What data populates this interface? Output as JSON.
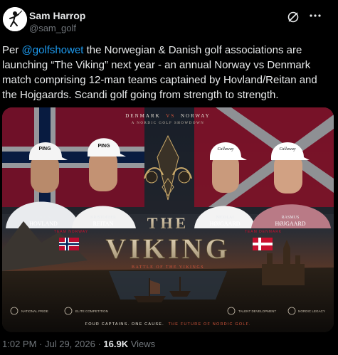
{
  "author": {
    "name": "Sam Harrop",
    "handle": "@sam_golf",
    "avatar_icon": "golfer-avatar-icon"
  },
  "tweet": {
    "text_before": "Per ",
    "mention": "@golfshowet",
    "text_after": " the Norwegian & Danish golf associations are launching “The Viking” next year - an annual Norway vs Denmark match comprising 12-man teams captained by Hovland/Reitan and the Hojgaards. Scandi golf going from strength to strength."
  },
  "poster": {
    "top_line_a": "DENMARK",
    "top_line_vs": "VS",
    "top_line_b": "NORWAY",
    "subtitle": "A NORDIC GOLF SHOWDOWN",
    "players": [
      {
        "first": "VIKTOR",
        "last": "HOVLAND",
        "cap": "PING"
      },
      {
        "first": "KRISTOFFER",
        "last": "REITAN",
        "cap": "PING"
      },
      {
        "first": "NICOLAI",
        "last": "HØJGAARD",
        "cap": "Callaway"
      },
      {
        "first": "RASMUS",
        "last": "HØJGAARD",
        "cap": "Callaway"
      }
    ],
    "team_norway": "TEAM NORWAY",
    "team_denmark": "TEAM DENMARK",
    "title_the": "THE",
    "title_main": "VIKING",
    "tagline": "BATTLE OF THE VIKINGS",
    "pillars": [
      "NATIONAL PRIDE",
      "ELITE COMPETITION",
      "TALENT DEVELOPMENT",
      "NORDIC LEGACY"
    ],
    "footer_a": "FOUR CAPTAINS. ONE CAUSE.",
    "footer_b": "THE FUTURE OF NORDIC GOLF."
  },
  "meta": {
    "time": "1:02 PM",
    "sep": " · ",
    "date": "Jul 29, 2026",
    "sep2": " · ",
    "views": "16.9K",
    "views_label": " Views"
  },
  "colors": {
    "accent": "#1d9bf0",
    "muted": "#71767b",
    "norway_red": "#ba0c2f",
    "norway_blue": "#00205b",
    "denmark_red": "#c8102e",
    "gold": "#c9a96a"
  }
}
